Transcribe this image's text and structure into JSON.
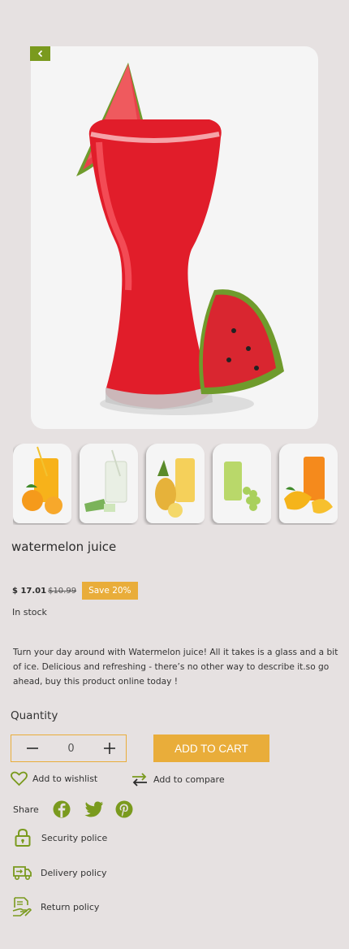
{
  "product": {
    "title": "watermelon juice",
    "price_now": "$ 17.01",
    "price_old": "$10.99",
    "save_badge": "Save 20%",
    "stock": "In stock",
    "description": "Turn your day around with Watermelon juice! All it takes is a glass and a bit of ice. Delicious and refreshing - there’s no other way to describe it.so go ahead, buy this product online today !"
  },
  "thumbnails": [
    {
      "name": "orange-juice"
    },
    {
      "name": "aloe-juice"
    },
    {
      "name": "pineapple-juice"
    },
    {
      "name": "grape-juice"
    },
    {
      "name": "mango-juice"
    }
  ],
  "quantity": {
    "label": "Quantity",
    "value": "0"
  },
  "actions": {
    "add_to_cart": "ADD TO CART",
    "wishlist": "Add to wishlist",
    "compare": "Add to compare",
    "share": "Share"
  },
  "policies": {
    "security": "Security police",
    "delivery": "Delivery policy",
    "return": "Return policy"
  },
  "colors": {
    "accent": "#e9ad3a",
    "green": "#7a9a1e",
    "background": "#e6e1e1"
  }
}
